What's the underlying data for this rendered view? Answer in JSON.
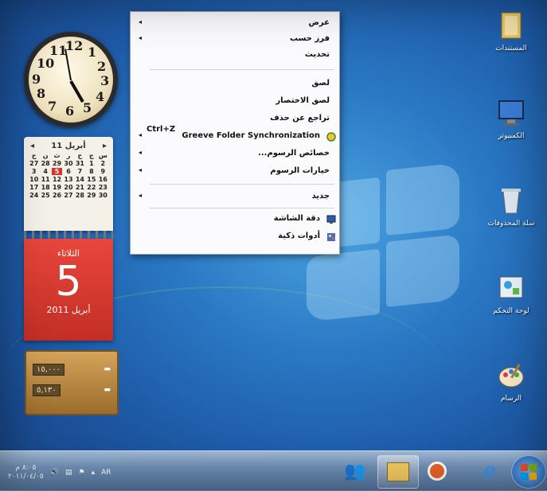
{
  "context_menu": {
    "items": [
      {
        "label": "عرض",
        "arrow": "◂"
      },
      {
        "label": "فرز حسب",
        "arrow": "◂"
      },
      {
        "label": "تحديث"
      },
      {
        "label": "لصق"
      },
      {
        "label": "لصق الاختصار"
      },
      {
        "label": "تراجع عن حذف",
        "shortcut": "Ctrl+Z"
      },
      {
        "label": "Greeve Folder Synchronization",
        "arrow": "◂"
      },
      {
        "label": "خصائص الرسوم...",
        "arrow": "◂"
      },
      {
        "label": "خيارات الرسوم",
        "arrow": "◂"
      },
      {
        "label": "جديد",
        "arrow": "◂"
      },
      {
        "label": "دقة الشاشة"
      },
      {
        "label": "أدوات ذكية"
      }
    ]
  },
  "calendar": {
    "month_label": "أبريل 11",
    "day_name": "الثلاثاء",
    "day_number": "5",
    "month_year": "2011 أبريل",
    "today": "5"
  },
  "currency": {
    "amount_1": "١٥,٠٠٠",
    "amount_2": "٥,١٣٠"
  },
  "desktop_icons": [
    {
      "label": "المستندات",
      "icon": "folder-icon"
    },
    {
      "label": "الكمبيوتر",
      "icon": "computer-icon"
    },
    {
      "label": "سلة المحذوفات",
      "icon": "recycle-bin-icon"
    },
    {
      "label": "لوحة التحكم",
      "icon": "control-panel-icon"
    },
    {
      "label": "الرسام",
      "icon": "paint-icon"
    }
  ],
  "taskbar": {
    "clock_time": "٨:٠٥ م",
    "clock_date": "٢٠١١/٠٤/٠٥",
    "lang": "AR"
  },
  "colors": {
    "desktop_blue": "#2a78c4",
    "calendar_red": "#d8322a"
  }
}
